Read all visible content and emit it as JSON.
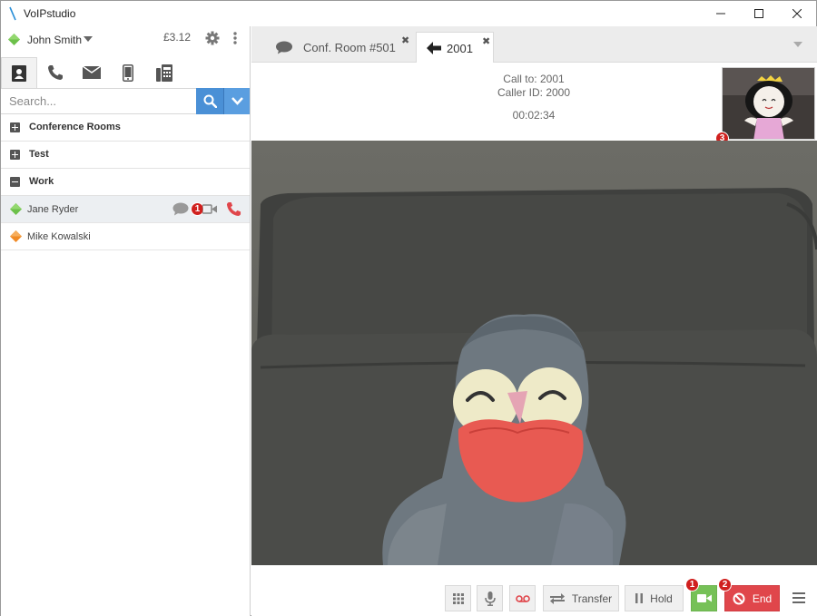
{
  "window": {
    "title": "VoIPstudio",
    "controls": [
      "minimize",
      "maximize",
      "close"
    ]
  },
  "user": {
    "name": "John Smith",
    "status": "online",
    "balance": "£3.12"
  },
  "nav_tabs": [
    {
      "icon": "contacts-icon",
      "active": true
    },
    {
      "icon": "phone-icon",
      "active": false
    },
    {
      "icon": "envelope-icon",
      "active": false
    },
    {
      "icon": "mobile-icon",
      "active": false
    },
    {
      "icon": "fax-icon",
      "active": false
    }
  ],
  "search": {
    "placeholder": "Search...",
    "value": ""
  },
  "groups": [
    {
      "label": "Conference Rooms",
      "expanded": false
    },
    {
      "label": "Test",
      "expanded": false
    },
    {
      "label": "Work",
      "expanded": true
    }
  ],
  "contacts": [
    {
      "name": "Jane Ryder",
      "status": "online",
      "status_color": "#6cc04a",
      "selected": true,
      "badge": "1"
    },
    {
      "name": "Mike Kowalski",
      "status": "away",
      "status_color": "#f08a24",
      "selected": false
    }
  ],
  "conversation_tabs": [
    {
      "label": "Conf. Room #501",
      "icon": "chat-icon",
      "active": false
    },
    {
      "label": "2001",
      "icon": "arrow-left-icon",
      "active": true
    }
  ],
  "call": {
    "call_to": "Call to: 2001",
    "caller_id": "Caller ID: 2000",
    "duration": "00:02:34",
    "self_view_badge": "3"
  },
  "controls": {
    "transfer_label": "Transfer",
    "hold_label": "Hold",
    "end_label": "End",
    "video_badge": "1",
    "end_badge": "2"
  },
  "colors": {
    "accent_blue": "#4a90d6",
    "video_green": "#76c157",
    "end_red": "#e0464b",
    "badge_red": "#d0201e",
    "call_red": "#e0464b"
  }
}
